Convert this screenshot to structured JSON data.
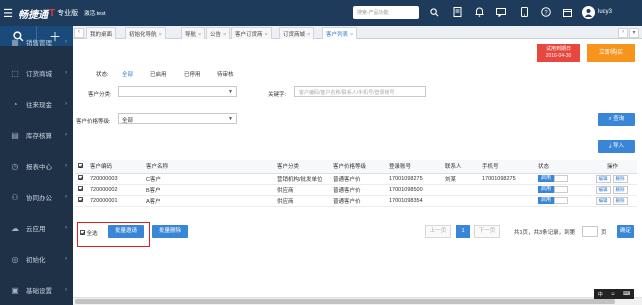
{
  "topbar": {
    "logo": "畅捷通",
    "edition": "专业版",
    "activate": "激活.test",
    "search_placeholder": "搜索-产品功能",
    "username": "lucy3"
  },
  "sidebar": {
    "items": [
      {
        "label": "销售管理",
        "icon": "sales-icon"
      },
      {
        "label": "订货商城",
        "icon": "cart-icon"
      },
      {
        "label": "往来现金",
        "icon": "cash-icon"
      },
      {
        "label": "库存核算",
        "icon": "inventory-icon"
      },
      {
        "label": "报表中心",
        "icon": "report-icon"
      },
      {
        "label": "协同办公",
        "icon": "collab-icon"
      },
      {
        "label": "云应用",
        "icon": "cloud-icon"
      },
      {
        "label": "初始化",
        "icon": "init-icon"
      },
      {
        "label": "基础设置",
        "icon": "settings-icon"
      }
    ]
  },
  "tabs": [
    {
      "label": "我的桌面",
      "closable": false
    },
    {
      "label": "初始化导航",
      "closable": true
    },
    {
      "label": "导航",
      "closable": true
    },
    {
      "label": "公告",
      "closable": true
    },
    {
      "label": "客户订货商",
      "closable": true
    },
    {
      "label": "订货商城",
      "closable": true
    },
    {
      "label": "客户列表",
      "closable": true,
      "active": true
    }
  ],
  "promo": {
    "trial_line1": "试用到期日",
    "trial_line2": "2016-04-30",
    "buy": "立即购买"
  },
  "filters": {
    "status_label": "状态:",
    "status_options": [
      "全部",
      "已启用",
      "已停用",
      "待审核"
    ],
    "category_label": "客户分类:",
    "keyword_label": "关键字:",
    "keyword_placeholder": "客户编码/客户名称/联系人/手机号/登录账号",
    "price_level_label": "客户价格等级:",
    "price_level_value": "全部",
    "query_button": "查询",
    "import_button": "导入"
  },
  "table": {
    "headers": [
      "客户编码",
      "客户名称",
      "客户分类",
      "客户价格等级",
      "登录账号",
      "联系人",
      "手机号",
      "状态",
      "操作"
    ],
    "rows": [
      {
        "code": "720000003",
        "name": "C客户",
        "category": "营销机构/批发单位",
        "price_level": "普通客户价",
        "account": "17001098275",
        "contact": "刘某",
        "phone": "17001098275",
        "status": "启用",
        "edit": "编辑",
        "delete": "删除"
      },
      {
        "code": "720000002",
        "name": "B客户",
        "category": "供应商",
        "price_level": "普通客户价",
        "account": "17001098500",
        "contact": "",
        "phone": "",
        "status": "启用",
        "edit": "编辑",
        "delete": "删除"
      },
      {
        "code": "720000001",
        "name": "A客户",
        "category": "供应商",
        "price_level": "普通客户价",
        "account": "17001098354",
        "contact": "",
        "phone": "",
        "status": "启用",
        "edit": "编辑",
        "delete": "删除"
      }
    ]
  },
  "footer": {
    "select_all": "全选",
    "batch_invite": "批量邀请",
    "batch_delete": "批量删除",
    "prev_page": "上一页",
    "current_page": "1",
    "next_page": "下一页",
    "summary": "共1页，共3条记录，到第",
    "page_unit": "页",
    "goto_button": "确定"
  }
}
